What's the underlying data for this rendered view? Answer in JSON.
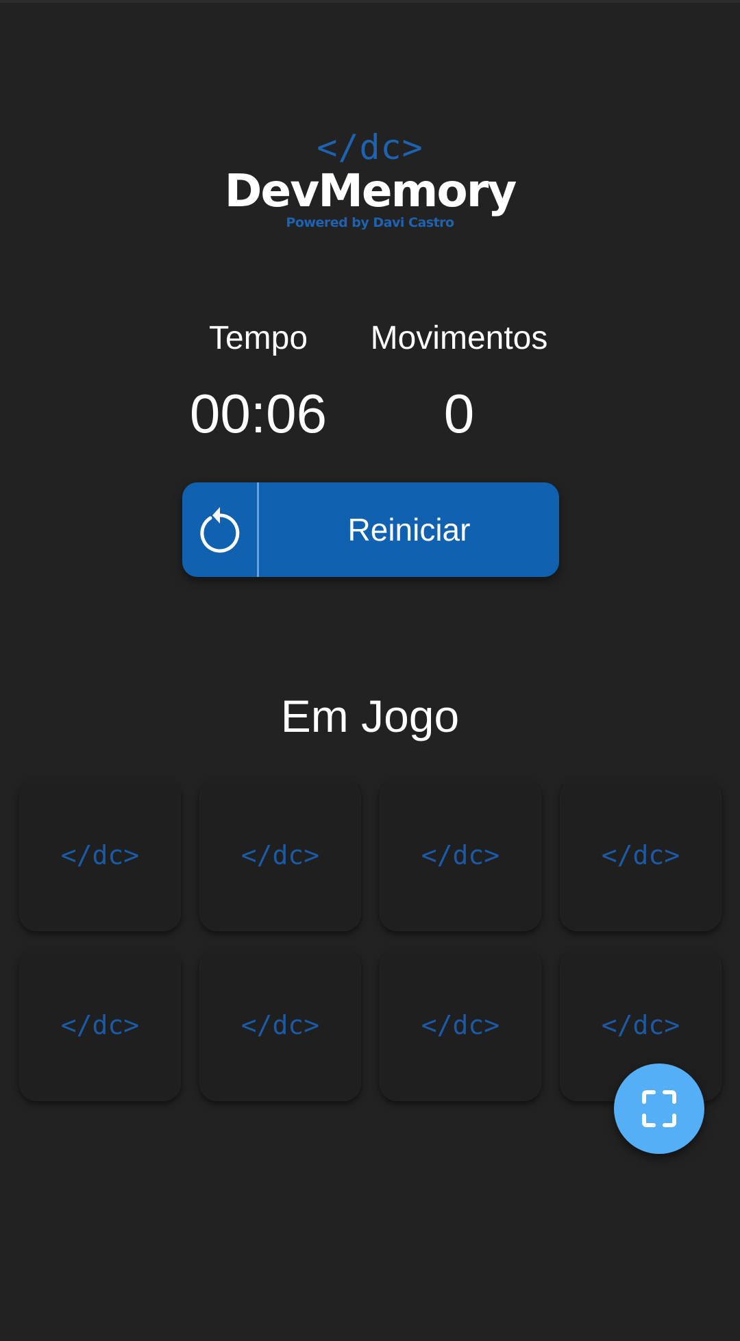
{
  "logo": {
    "mark": "</dc>",
    "title": "DevMemory",
    "powered_by": "Powered by Davi Castro"
  },
  "stats": {
    "time_label": "Tempo",
    "time_value": "00:06",
    "moves_label": "Movimentos",
    "moves_value": "0"
  },
  "restart": {
    "label": "Reiniciar",
    "icon": "restart-icon"
  },
  "game": {
    "status": "Em Jogo",
    "cards": [
      {
        "face": "</dc>"
      },
      {
        "face": "</dc>"
      },
      {
        "face": "</dc>"
      },
      {
        "face": "</dc>"
      },
      {
        "face": "</dc>"
      },
      {
        "face": "</dc>"
      },
      {
        "face": "</dc>"
      },
      {
        "face": "</dc>"
      }
    ]
  },
  "fab": {
    "icon": "fullscreen-icon"
  },
  "colors": {
    "background": "#222222",
    "accent": "#1061b0",
    "brand_blue": "#1d63b4",
    "fab": "#54aff7",
    "card": "#1f1f1f"
  }
}
